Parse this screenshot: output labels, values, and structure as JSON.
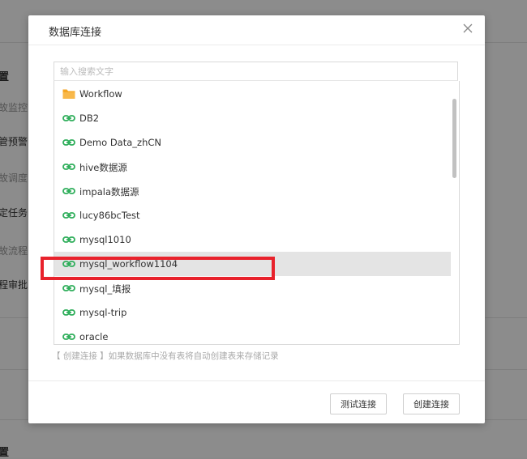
{
  "background": {
    "items": [
      "置",
      "故监控",
      "管预警:",
      "故调度",
      "定任务:",
      "故流程",
      "程审批:",
      "置"
    ]
  },
  "dialog": {
    "title": "数据库连接",
    "search": {
      "placeholder": "输入搜索文字",
      "value": ""
    },
    "items": [
      {
        "label": "Workflow",
        "icon": "folder-icon",
        "selected": false
      },
      {
        "label": "DB2",
        "icon": "link-icon",
        "selected": false
      },
      {
        "label": "Demo Data_zhCN",
        "icon": "link-icon",
        "selected": false
      },
      {
        "label": "hive数据源",
        "icon": "link-icon",
        "selected": false
      },
      {
        "label": "impala数据源",
        "icon": "link-icon",
        "selected": false
      },
      {
        "label": "lucy86bcTest",
        "icon": "link-icon",
        "selected": false
      },
      {
        "label": "mysql1010",
        "icon": "link-icon",
        "selected": false
      },
      {
        "label": "mysql_workflow1104",
        "icon": "link-icon",
        "selected": true
      },
      {
        "label": "mysql_填报",
        "icon": "link-icon",
        "selected": false
      },
      {
        "label": "mysql-trip",
        "icon": "link-icon",
        "selected": false
      },
      {
        "label": "oracle",
        "icon": "link-icon",
        "selected": false
      }
    ],
    "hint": "【 创建连接 】如果数据库中没有表将自动创建表来存储记录",
    "buttons": {
      "test": "测试连接",
      "create": "创建连接"
    }
  },
  "colors": {
    "accent_green": "#2fae5b",
    "folder_orange": "#f5a623",
    "highlight_red": "#e8222c",
    "selected_bg": "#e4e4e4"
  }
}
